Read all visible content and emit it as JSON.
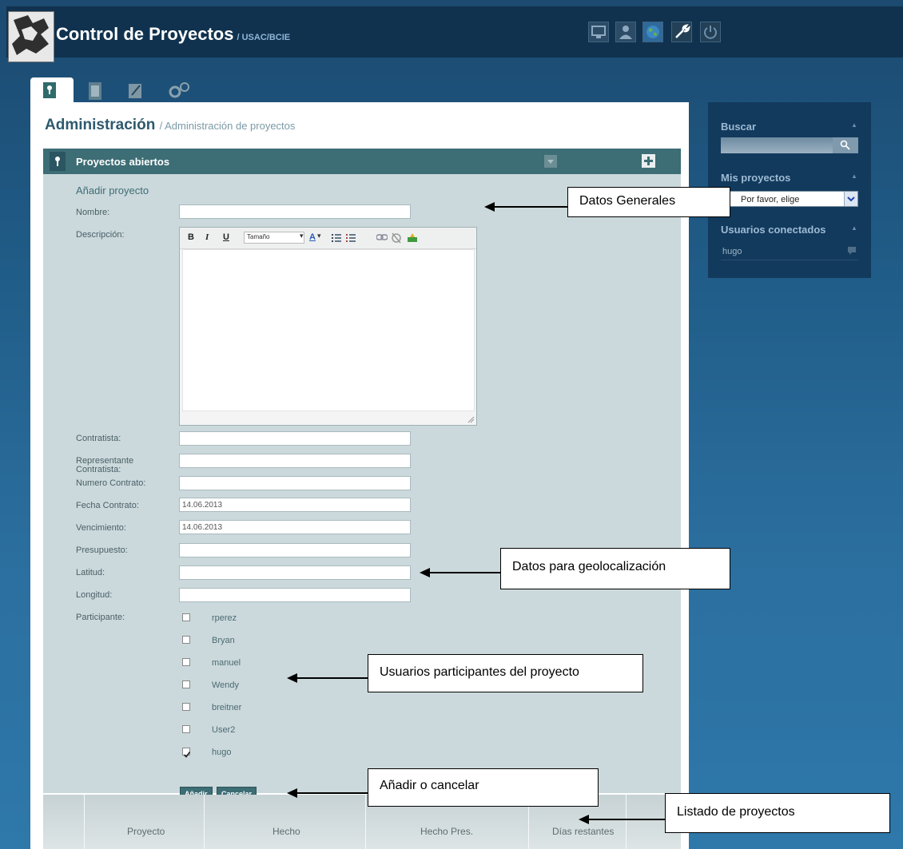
{
  "app": {
    "title": "Control de Proyectos",
    "subtitle": "/ USAC/BCIE"
  },
  "top_icons": [
    "monitor-icon",
    "user-icon",
    "globe-icon",
    "wrench-icon",
    "power-icon"
  ],
  "tabs": [
    "projects-tab-icon",
    "clipboard-tab-icon",
    "edit-tab-icon",
    "settings-tab-icon"
  ],
  "page": {
    "title": "Administración",
    "breadcrumb": "/ Administración de proyectos"
  },
  "section": {
    "title": "Proyectos abiertos"
  },
  "form": {
    "title": "Añadir proyecto",
    "labels": {
      "nombre": "Nombre:",
      "descripcion": "Descripción:",
      "contratista": "Contratista:",
      "representante": "Representante Contratista:",
      "numero_contrato": "Numero Contrato:",
      "fecha_contrato": "Fecha Contrato:",
      "vencimiento": "Vencimiento:",
      "presupuesto": "Presupuesto:",
      "latitud": "Latitud:",
      "longitud": "Longitud:",
      "participante": "Participante:"
    },
    "values": {
      "nombre": "",
      "contratista": "",
      "representante": "",
      "numero_contrato": "",
      "fecha_contrato": "14.06.2013",
      "vencimiento": "14.06.2013",
      "presupuesto": "",
      "latitud": "",
      "longitud": ""
    },
    "editor": {
      "size_label": "Tamaño",
      "bold": "B",
      "italic": "I",
      "underline": "U",
      "font_color": "A"
    },
    "participants": [
      {
        "name": "rperez",
        "checked": false
      },
      {
        "name": "Bryan",
        "checked": false
      },
      {
        "name": "manuel",
        "checked": false
      },
      {
        "name": "Wendy",
        "checked": false
      },
      {
        "name": "breitner",
        "checked": false
      },
      {
        "name": "User2",
        "checked": false
      },
      {
        "name": "hugo",
        "checked": true
      }
    ],
    "add_button": "Añadir",
    "cancel_button": "Cancelar"
  },
  "table": {
    "columns": [
      "Proyecto",
      "Hecho",
      "Hecho Pres.",
      "Días restantes"
    ]
  },
  "sidebar": {
    "search_title": "Buscar",
    "my_projects_title": "Mis proyectos",
    "my_projects_value": "Por favor, elige",
    "connected_title": "Usuarios conectados",
    "connected_users": [
      "hugo"
    ]
  },
  "callouts": {
    "general": "Datos Generales",
    "geo": "Datos para geolocalización",
    "users": "Usuarios participantes del proyecto",
    "add_cancel": "Añadir o cancelar",
    "list": "Listado de proyectos"
  },
  "colors": {
    "header_bg": "#10324f",
    "section_bg": "#3d6d75",
    "form_bg": "#cbd9dc",
    "accent": "#2d5a6e"
  }
}
